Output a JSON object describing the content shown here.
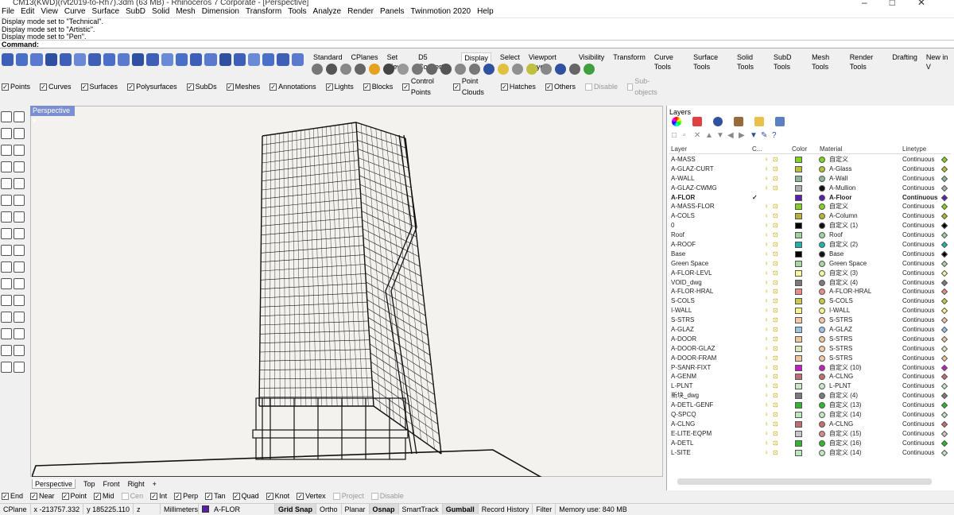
{
  "titlebar": {
    "title": "CM13(KWD)(rvt2019-to-Rh7).3dm (63 MB) - Rhinoceros 7 Corporate - [Perspective]"
  },
  "menu": [
    "File",
    "Edit",
    "View",
    "Curve",
    "Surface",
    "SubD",
    "Solid",
    "Mesh",
    "Dimension",
    "Transform",
    "Tools",
    "Analyze",
    "Render",
    "Panels",
    "Twinmotion 2020",
    "Help"
  ],
  "history": [
    "Display mode set to \"Technical\".",
    "Display mode set to \"Artistic\".",
    "Display mode set to \"Pen\"."
  ],
  "command": {
    "label": "Command:",
    "value": ""
  },
  "tabs": [
    "Standard",
    "CPlanes",
    "Set View",
    "D5 Converter",
    "Display",
    "Select",
    "Viewport Layout",
    "Visibility",
    "Transform",
    "Curve Tools",
    "Surface Tools",
    "Solid Tools",
    "SubD Tools",
    "Mesh Tools",
    "Render Tools",
    "Drafting",
    "New in V"
  ],
  "active_tab": "Display",
  "filters": [
    {
      "label": "Points",
      "on": true
    },
    {
      "label": "Curves",
      "on": true
    },
    {
      "label": "Surfaces",
      "on": true
    },
    {
      "label": "Polysurfaces",
      "on": true
    },
    {
      "label": "SubDs",
      "on": true
    },
    {
      "label": "Meshes",
      "on": true
    },
    {
      "label": "Annotations",
      "on": true
    },
    {
      "label": "Lights",
      "on": true
    },
    {
      "label": "Blocks",
      "on": true
    },
    {
      "label": "Control Points",
      "on": true
    },
    {
      "label": "Point Clouds",
      "on": true
    },
    {
      "label": "Hatches",
      "on": true
    },
    {
      "label": "Others",
      "on": true
    },
    {
      "label": "Disable",
      "on": false
    },
    {
      "label": "Sub-objects",
      "on": false
    }
  ],
  "viewport": {
    "name": "Perspective",
    "tabs": [
      "Perspective",
      "Top",
      "Front",
      "Right"
    ]
  },
  "layers_panel": {
    "title": "Layers",
    "headers": {
      "layer": "Layer",
      "current": "C...",
      "color": "Color",
      "material": "Material",
      "linetype": "Linetype"
    },
    "rows": [
      {
        "name": "A-MASS",
        "current": "",
        "color": "#7ed321",
        "mat_color": "#7ed321",
        "material": "自定义",
        "linetype": "Continuous"
      },
      {
        "name": "A-GLAZ-CURT",
        "current": "",
        "color": "#b6c236",
        "mat_color": "#b6c236",
        "material": "A-Glass",
        "linetype": "Continuous"
      },
      {
        "name": "A-WALL",
        "current": "",
        "color": "#8fb69a",
        "mat_color": "#8fb69a",
        "material": "A-Wall",
        "linetype": "Continuous"
      },
      {
        "name": "A-GLAZ-CWMG",
        "current": "",
        "color": "#b0b0b0",
        "mat_color": "#111111",
        "material": "A-Mullion",
        "linetype": "Continuous"
      },
      {
        "name": "A-FLOR",
        "current": "✓",
        "color": "#5a1fa8",
        "mat_color": "#5a1fa8",
        "material": "A-Floor",
        "linetype": "Continuous"
      },
      {
        "name": "A-MASS-FLOR",
        "current": "",
        "color": "#7ed321",
        "mat_color": "#7ed321",
        "material": "自定义",
        "linetype": "Continuous"
      },
      {
        "name": "A-COLS",
        "current": "",
        "color": "#b6b236",
        "mat_color": "#b6b236",
        "material": "A-Column",
        "linetype": "Continuous"
      },
      {
        "name": "0",
        "current": "",
        "color": "#000000",
        "mat_color": "#111111",
        "material": "自定义 (1)",
        "linetype": "Continuous"
      },
      {
        "name": "Roof",
        "current": "",
        "color": "#9fd29f",
        "mat_color": "#9fd29f",
        "material": "Roof",
        "linetype": "Continuous"
      },
      {
        "name": "A-ROOF",
        "current": "",
        "color": "#20b2aa",
        "mat_color": "#20b2aa",
        "material": "自定义 (2)",
        "linetype": "Continuous"
      },
      {
        "name": "Base",
        "current": "",
        "color": "#000000",
        "mat_color": "#111111",
        "material": "Base",
        "linetype": "Continuous"
      },
      {
        "name": "Green Space",
        "current": "",
        "color": "#a7d6a0",
        "mat_color": "#a7d6a0",
        "material": "Green Space",
        "linetype": "Continuous"
      },
      {
        "name": "A-FLOR-LEVL",
        "current": "",
        "color": "#f6f6a0",
        "mat_color": "#f6f6a0",
        "material": "自定义 (3)",
        "linetype": "Continuous"
      },
      {
        "name": "VOID_dwg",
        "current": "",
        "color": "#7a7a7a",
        "mat_color": "#7a7a7a",
        "material": "自定义 (4)",
        "linetype": "Continuous"
      },
      {
        "name": "A-FLOR-HRAL",
        "current": "",
        "color": "#e98b8b",
        "mat_color": "#e98b8b",
        "material": "A-FLOR-HRAL",
        "linetype": "Continuous"
      },
      {
        "name": "S-COLS",
        "current": "",
        "color": "#c8c84a",
        "mat_color": "#c8c84a",
        "material": "S-COLS",
        "linetype": "Continuous"
      },
      {
        "name": "I-WALL",
        "current": "",
        "color": "#f4f48a",
        "mat_color": "#f4f48a",
        "material": "I-WALL",
        "linetype": "Continuous"
      },
      {
        "name": "S-STRS",
        "current": "",
        "color": "#f4c9a8",
        "mat_color": "#f4c9a8",
        "material": "S-STRS",
        "linetype": "Continuous"
      },
      {
        "name": "A-GLAZ",
        "current": "",
        "color": "#9cc3e6",
        "mat_color": "#9cc3e6",
        "material": "A-GLAZ",
        "linetype": "Continuous"
      },
      {
        "name": "A-DOOR",
        "current": "",
        "color": "#f0c8a0",
        "mat_color": "#f0c8a0",
        "material": "S-STRS",
        "linetype": "Continuous"
      },
      {
        "name": "A-DOOR-GLAZ",
        "current": "",
        "color": "#d9e9b8",
        "mat_color": "#f4c9a8",
        "material": "S-STRS",
        "linetype": "Continuous"
      },
      {
        "name": "A-DOOR-FRAM",
        "current": "",
        "color": "#f0c8a0",
        "mat_color": "#f4c9a8",
        "material": "S-STRS",
        "linetype": "Continuous"
      },
      {
        "name": "P-SANR-FIXT",
        "current": "",
        "color": "#c020c0",
        "mat_color": "#c020c0",
        "material": "自定义 (10)",
        "linetype": "Continuous"
      },
      {
        "name": "A-GENM",
        "current": "",
        "color": "#c07070",
        "mat_color": "#c07070",
        "material": "A-CLNG",
        "linetype": "Continuous"
      },
      {
        "name": "L-PLNT",
        "current": "",
        "color": "#c8e8c8",
        "mat_color": "#c8e8c8",
        "material": "L-PLNT",
        "linetype": "Continuous"
      },
      {
        "name": "新块_dwg",
        "current": "",
        "color": "#7a7a7a",
        "mat_color": "#7a7a7a",
        "material": "自定义 (4)",
        "linetype": "Continuous"
      },
      {
        "name": "A-DETL-GENF",
        "current": "",
        "color": "#2eb82e",
        "mat_color": "#2eb82e",
        "material": "自定义 (13)",
        "linetype": "Continuous"
      },
      {
        "name": "Q-SPCQ",
        "current": "",
        "color": "#bde8bd",
        "mat_color": "#bde8bd",
        "material": "自定义 (14)",
        "linetype": "Continuous"
      },
      {
        "name": "A-CLNG",
        "current": "",
        "color": "#c07070",
        "mat_color": "#c07070",
        "material": "A-CLNG",
        "linetype": "Continuous"
      },
      {
        "name": "E-LITE-EQPM",
        "current": "",
        "color": "#c8c8c8",
        "mat_color": "#d08a8a",
        "material": "自定义 (15)",
        "linetype": "Continuous"
      },
      {
        "name": "A-DETL",
        "current": "",
        "color": "#2eb82e",
        "mat_color": "#2eb82e",
        "material": "自定义 (16)",
        "linetype": "Continuous"
      },
      {
        "name": "L-SITE",
        "current": "",
        "color": "#bde8bd",
        "mat_color": "#bde8bd",
        "material": "自定义 (14)",
        "linetype": "Continuous"
      }
    ]
  },
  "osnaps": [
    {
      "label": "End",
      "on": true
    },
    {
      "label": "Near",
      "on": true
    },
    {
      "label": "Point",
      "on": true
    },
    {
      "label": "Mid",
      "on": true
    },
    {
      "label": "Cen",
      "on": false
    },
    {
      "label": "Int",
      "on": true
    },
    {
      "label": "Perp",
      "on": true
    },
    {
      "label": "Tan",
      "on": true
    },
    {
      "label": "Quad",
      "on": true
    },
    {
      "label": "Knot",
      "on": true
    },
    {
      "label": "Vertex",
      "on": true
    },
    {
      "label": "Project",
      "on": false
    },
    {
      "label": "Disable",
      "on": false
    }
  ],
  "status": {
    "cplane": "CPlane",
    "x": "x -213757.332",
    "y": "y 185225.110",
    "z": "z",
    "units": "Millimeters",
    "layer": "A-FLOR",
    "layer_color": "#5a1fa8",
    "buttons": [
      "Grid Snap",
      "Ortho",
      "Planar",
      "Osnap",
      "SmartTrack",
      "Gumball",
      "Record History",
      "Filter"
    ],
    "memory": "Memory use: 840 MB"
  }
}
